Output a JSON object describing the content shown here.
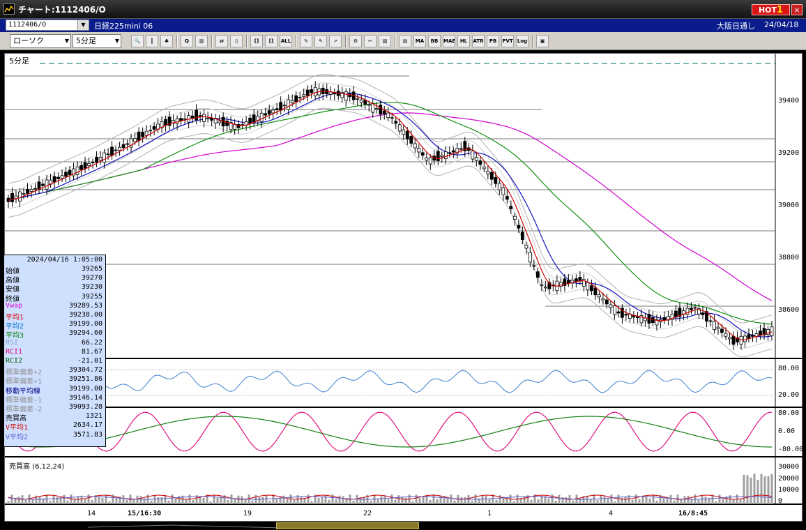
{
  "window": {
    "title": "チャート:1112406/O",
    "hot_label": "HOT",
    "hot_number": "1",
    "close_symbol": "×"
  },
  "symbol_bar": {
    "symbol_code": "1112406/O",
    "symbol_name": "日経225mini 06",
    "session": "大阪日通し",
    "date": "24/04/18"
  },
  "toolbar": {
    "chart_type": "ローソク",
    "interval": "5分足",
    "buttons": [
      {
        "name": "zoom-button",
        "text": "🔍"
      },
      {
        "name": "cursor-button",
        "text": "┃"
      },
      {
        "name": "print-button",
        "text": "♣"
      },
      {
        "name": "search-button",
        "text": "Q"
      },
      {
        "name": "chart-add-button",
        "text": "▥"
      },
      {
        "name": "swap-button",
        "text": "⇄"
      },
      {
        "name": "inactive-button",
        "text": "▯"
      },
      {
        "name": "candle-button",
        "text": "[]"
      },
      {
        "name": "candle2-button",
        "text": "[]"
      },
      {
        "name": "all-button",
        "text": "ALL"
      },
      {
        "name": "pen-button",
        "text": "✎"
      },
      {
        "name": "pointer-button",
        "text": "↖"
      },
      {
        "name": "arrow-button",
        "text": "➚"
      },
      {
        "name": "gear-button",
        "text": "⚙"
      },
      {
        "name": "tool-button",
        "text": "✂"
      },
      {
        "name": "palette-button",
        "text": "▨"
      },
      {
        "name": "indicator-button",
        "text": "▤"
      },
      {
        "name": "ma-button",
        "text": "MA"
      },
      {
        "name": "bb-button",
        "text": "BB"
      },
      {
        "name": "mae-button",
        "text": "MAE"
      },
      {
        "name": "hl-button",
        "text": "HL"
      },
      {
        "name": "atr-button",
        "text": "ATR"
      },
      {
        "name": "pbsa-button",
        "text": "PB"
      },
      {
        "name": "pvt-button",
        "text": "PVT"
      },
      {
        "name": "log-button",
        "text": "Log"
      },
      {
        "name": "layout-button",
        "text": "▣"
      }
    ]
  },
  "chart": {
    "period_label": "5分足",
    "volume_label": "売買高 (6,12,24)",
    "y_axis_price": [
      "39400",
      "39200",
      "39000",
      "38800",
      "38600"
    ],
    "y_axis_rsi": [
      "80.00",
      "20.00"
    ],
    "y_axis_rci": [
      "80.00",
      "0.00",
      "-80.00"
    ],
    "y_axis_volume": [
      "30000",
      "20000",
      "10000",
      "0"
    ],
    "x_axis": [
      {
        "label": "14",
        "bold": false
      },
      {
        "label": "15/16:30",
        "bold": true
      },
      {
        "label": "19",
        "bold": false
      },
      {
        "label": "22",
        "bold": false
      },
      {
        "label": "1",
        "bold": false
      },
      {
        "label": "4",
        "bold": false
      },
      {
        "label": "16/8:45",
        "bold": true
      }
    ]
  },
  "chart_data": {
    "type": "line",
    "title": "",
    "ylim": [
      38500,
      39550
    ],
    "series": [
      {
        "values": [
          39060,
          39120,
          39180,
          39250,
          39330,
          39360,
          39320,
          39380,
          39450,
          39430,
          39360,
          39200,
          39250,
          39090,
          38750,
          38780,
          38660,
          38630,
          38680,
          38560,
          38600
        ]
      }
    ]
  },
  "info_panel": {
    "datetime": "2024/04/16 1:05:00",
    "rows": [
      {
        "label": "始値",
        "value": "39265",
        "color": "#000000"
      },
      {
        "label": "高値",
        "value": "39270",
        "color": "#000000"
      },
      {
        "label": "安値",
        "value": "39230",
        "color": "#000000"
      },
      {
        "label": "終値",
        "value": "39255",
        "color": "#000000"
      },
      {
        "label": "Vwap",
        "value": "39289.53",
        "color": "#e000e0"
      },
      {
        "label": "平均1",
        "value": "39238.00",
        "color": "#d00000"
      },
      {
        "label": "平均2",
        "value": "39199.00",
        "color": "#0070d0"
      },
      {
        "label": "平均3",
        "value": "39294.60",
        "color": "#008000"
      },
      {
        "label": "RSI",
        "value": "66.22",
        "color": "#7f9fd0"
      },
      {
        "label": "RCI1",
        "value": "81.67",
        "color": "#e0007f"
      },
      {
        "label": "RCI2",
        "value": "-21.01",
        "color": "#006000"
      },
      {
        "label": "標準偏差+2",
        "value": "39304.72",
        "color": "#909090"
      },
      {
        "label": "標準偏差+1",
        "value": "39251.86",
        "color": "#909090"
      },
      {
        "label": "移動平均線",
        "value": "39199.00",
        "color": "#000080"
      },
      {
        "label": "標準偏差-1",
        "value": "39146.14",
        "color": "#909090"
      },
      {
        "label": "標準偏差-2",
        "value": "39093.28",
        "color": "#909090"
      },
      {
        "label": "売買高",
        "value": "1321",
        "color": "#000000"
      },
      {
        "label": "V平均1",
        "value": "2634.17",
        "color": "#d00000"
      },
      {
        "label": "V平均2",
        "value": "3571.83",
        "color": "#6060d0"
      }
    ]
  }
}
